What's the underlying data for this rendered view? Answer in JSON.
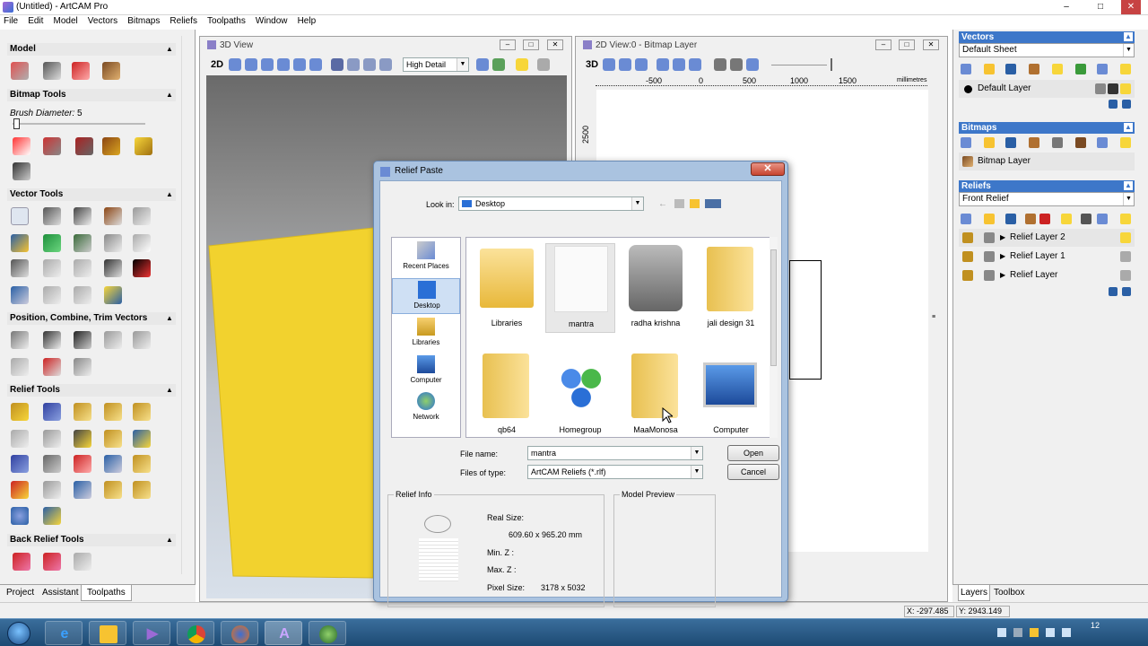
{
  "app": {
    "title": "(Untitled) - ArtCAM Pro",
    "window_buttons": [
      "–",
      "□",
      "✕"
    ]
  },
  "menu": [
    "File",
    "Edit",
    "Model",
    "Vectors",
    "Bitmaps",
    "Reliefs",
    "Toolpaths",
    "Window",
    "Help"
  ],
  "left_panel": {
    "sections": {
      "model": "Model",
      "bitmap_tools": "Bitmap Tools",
      "brush_diameter_label": "Brush Diameter:",
      "brush_diameter_value": "5",
      "vector_tools": "Vector Tools",
      "position": "Position, Combine, Trim Vectors",
      "relief_tools": "Relief Tools",
      "back_relief_tools": "Back Relief Tools"
    },
    "tabs": [
      "Project",
      "Assistant",
      "Toolpaths"
    ]
  },
  "view3d": {
    "title": "3D View",
    "mode": "2D",
    "detail": "High Detail"
  },
  "view2d": {
    "title": "2D View:0 - Bitmap Layer",
    "mode": "3D",
    "ruler_ticks": [
      "-500",
      "0",
      "500",
      "1000",
      "1500"
    ],
    "ruler_unit": "millimetres",
    "vertical_tick": "2500"
  },
  "right_panel": {
    "vectors": {
      "title": "Vectors",
      "sheet": "Default Sheet",
      "layer": "Default Layer"
    },
    "bitmaps": {
      "title": "Bitmaps",
      "layer": "Bitmap Layer"
    },
    "reliefs": {
      "title": "Reliefs",
      "select": "Front Relief",
      "layers": [
        "Relief Layer 2",
        "Relief Layer 1",
        "Relief Layer"
      ]
    },
    "tabs": [
      "Layers",
      "Toolbox"
    ]
  },
  "status": {
    "x": "X: -297.485",
    "y": "Y: 2943.149"
  },
  "dialog": {
    "title": "Relief Paste",
    "look_in_label": "Look in:",
    "look_in_value": "Desktop",
    "places": [
      "Recent Places",
      "Desktop",
      "Libraries",
      "Computer",
      "Network"
    ],
    "files": [
      "Libraries",
      "mantra",
      "radha krishna",
      "jali design 31",
      "qb64",
      "Homegroup",
      "MaaMonosa",
      "Computer"
    ],
    "file_name_label": "File name:",
    "file_name_value": "mantra",
    "files_of_type_label": "Files of type:",
    "files_of_type_value": "ArtCAM Reliefs (*.rlf)",
    "open_label": "Open",
    "cancel_label": "Cancel",
    "relief_info": {
      "title": "Relief Info",
      "real_size_label": "Real Size:",
      "real_size_value": "609.60 x 965.20 mm",
      "min_z_label": "Min. Z :",
      "max_z_label": "Max. Z :",
      "pixel_size_label": "Pixel Size:",
      "pixel_size_value": "3178 x 5032"
    },
    "model_preview_title": "Model Preview"
  },
  "taskbar": {
    "clock": "12"
  },
  "colors": {
    "accent_blue": "#3d77c9",
    "relief_yellow": "#f2d22e"
  }
}
